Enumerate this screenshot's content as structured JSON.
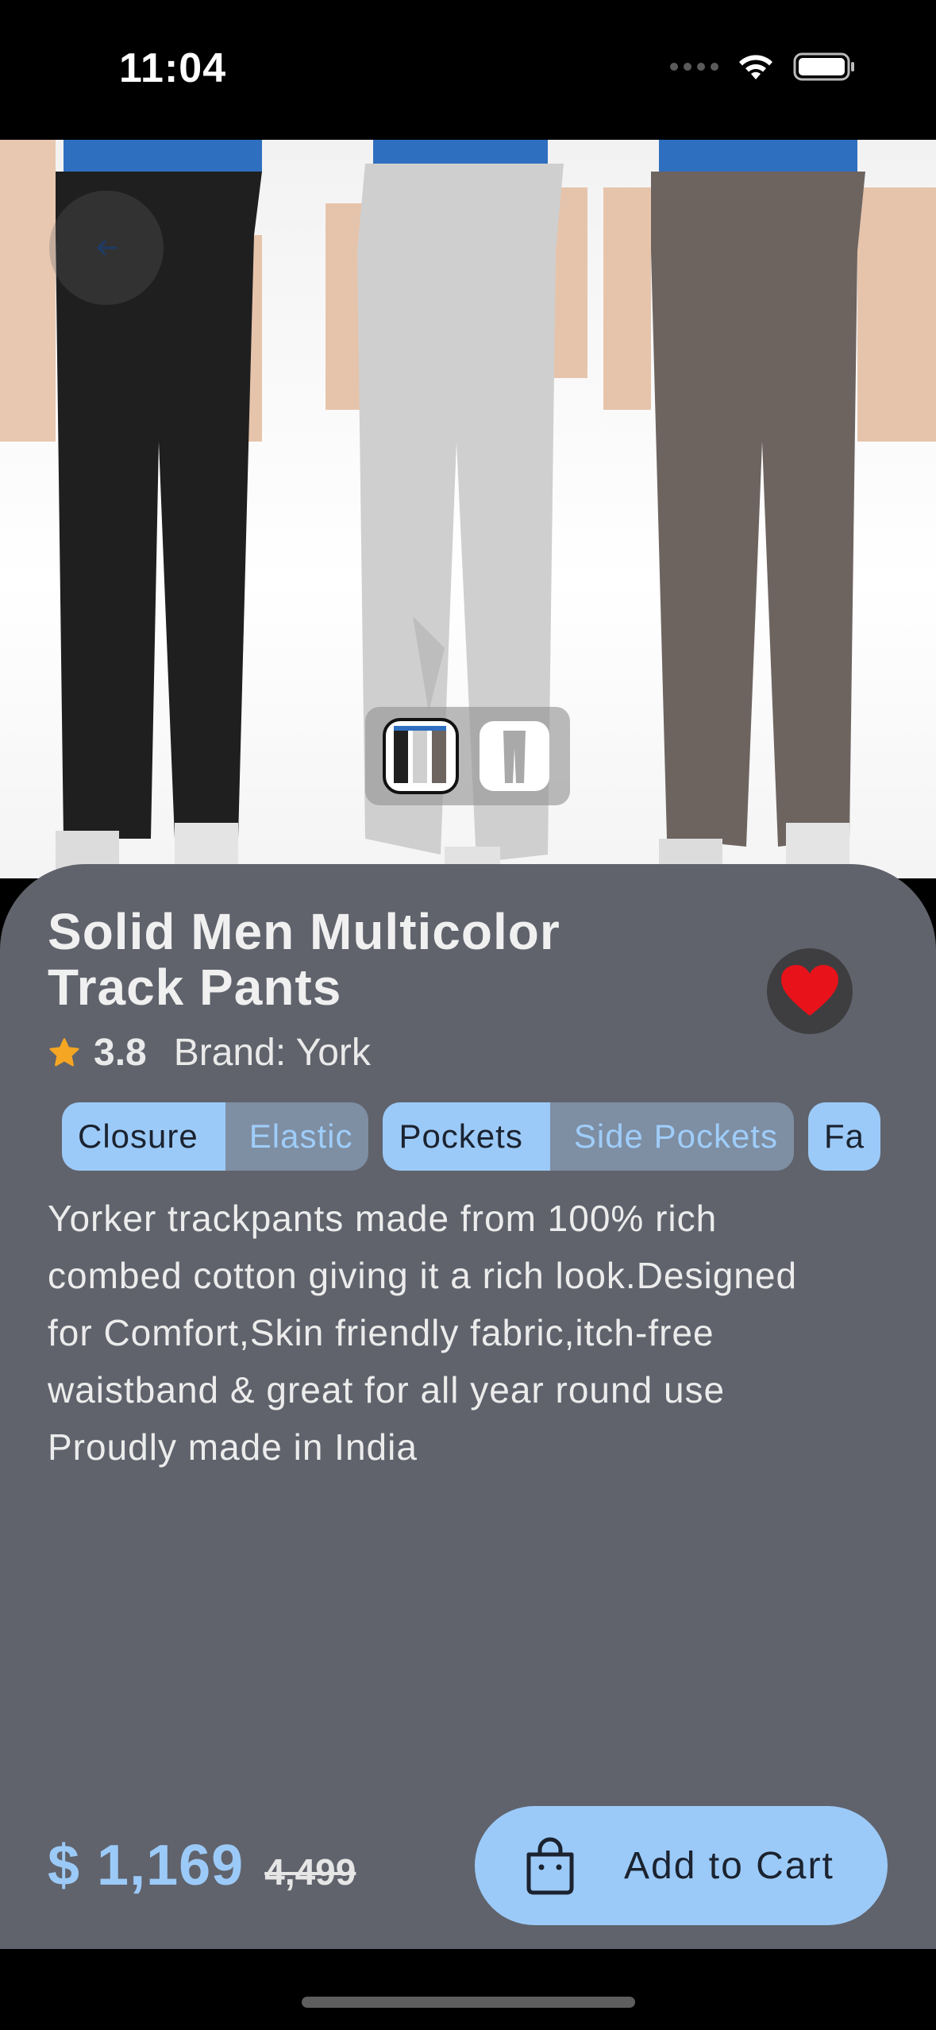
{
  "status_bar": {
    "time": "11:04",
    "icons": [
      "signal-dots-icon",
      "wifi-icon",
      "battery-icon"
    ]
  },
  "product": {
    "title": "Solid Men Multicolor Track Pants",
    "rating": "3.8",
    "brand_label": "Brand: York",
    "favorite": true,
    "attributes": [
      {
        "key": "Closure",
        "value": "Elastic"
      },
      {
        "key": "Pockets",
        "value": "Side Pockets"
      }
    ],
    "attribute_cut": "Fa",
    "description": "Yorker trackpants made from 100% rich combed cotton giving it a rich look.Designed for Comfort,Skin friendly fabric,itch-free waistband & great for all year round use Proudly made in India",
    "price_current": "$ 1,169",
    "price_original": "4,499",
    "image_count": 2,
    "active_image": 0
  },
  "actions": {
    "add_to_cart_label": "Add to Cart"
  },
  "colors": {
    "accent": "#9ccaf8",
    "sheet_background": "#60636c",
    "favorite": "#e8121a",
    "star": "#f5a623"
  }
}
